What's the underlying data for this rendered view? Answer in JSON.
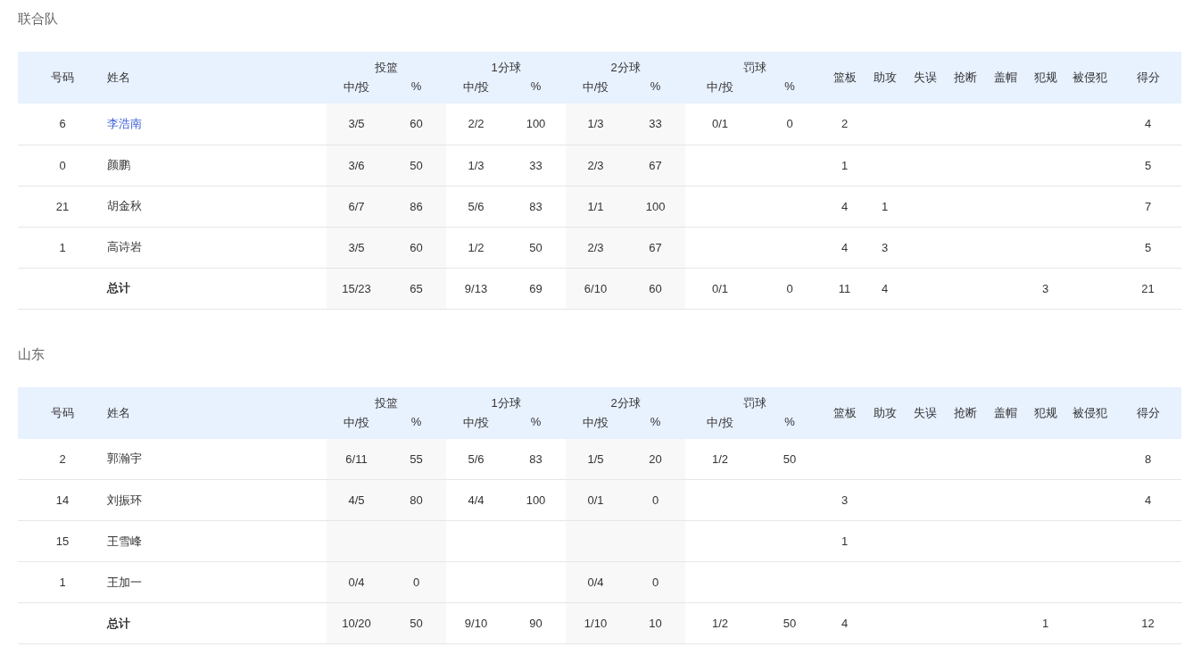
{
  "teams": [
    {
      "name": "联合队",
      "columns": [
        {
          "label": "号码"
        },
        {
          "label": "姓名"
        },
        {
          "label": "投篮",
          "sub": [
            "中/投",
            "%"
          ]
        },
        {
          "label": "1分球",
          "sub": [
            "中/投",
            "%"
          ]
        },
        {
          "label": "2分球",
          "sub": [
            "中/投",
            "%"
          ]
        },
        {
          "label": "罚球",
          "sub": [
            "中/投",
            "%"
          ]
        },
        {
          "label": "篮板"
        },
        {
          "label": "助攻"
        },
        {
          "label": "失误"
        },
        {
          "label": "抢断"
        },
        {
          "label": "盖帽"
        },
        {
          "label": "犯规"
        },
        {
          "label": "被侵犯"
        },
        {
          "label": "得分"
        }
      ],
      "rows": [
        {
          "kind": "player",
          "number": "6",
          "name": "李浩南",
          "link": true,
          "stats": {
            "fg_made": "3/5",
            "fg_pct": "60",
            "one_made": "2/2",
            "one_pct": "100",
            "two_made": "1/3",
            "two_pct": "33",
            "ft_made": "0/1",
            "ft_pct": "0",
            "reb": "2",
            "pts": "4"
          }
        },
        {
          "kind": "player",
          "number": "0",
          "name": "颜鹏",
          "link": false,
          "stats": {
            "fg_made": "3/6",
            "fg_pct": "50",
            "one_made": "1/3",
            "one_pct": "33",
            "two_made": "2/3",
            "two_pct": "67",
            "reb": "1",
            "pts": "5"
          }
        },
        {
          "kind": "player",
          "number": "21",
          "name": "胡金秋",
          "link": false,
          "stats": {
            "fg_made": "6/7",
            "fg_pct": "86",
            "one_made": "5/6",
            "one_pct": "83",
            "two_made": "1/1",
            "two_pct": "100",
            "reb": "4",
            "ast": "1",
            "pts": "7"
          }
        },
        {
          "kind": "player",
          "number": "1",
          "name": "高诗岩",
          "link": false,
          "stats": {
            "fg_made": "3/5",
            "fg_pct": "60",
            "one_made": "1/2",
            "one_pct": "50",
            "two_made": "2/3",
            "two_pct": "67",
            "reb": "4",
            "ast": "3",
            "pts": "5"
          }
        },
        {
          "kind": "total",
          "name": "总计",
          "stats": {
            "fg_made": "15/23",
            "fg_pct": "65",
            "one_made": "9/13",
            "one_pct": "69",
            "two_made": "6/10",
            "two_pct": "60",
            "ft_made": "0/1",
            "ft_pct": "0",
            "reb": "11",
            "ast": "4",
            "pf": "3",
            "pts": "21"
          }
        }
      ]
    },
    {
      "name": "山东",
      "columns": [
        {
          "label": "号码"
        },
        {
          "label": "姓名"
        },
        {
          "label": "投篮",
          "sub": [
            "中/投",
            "%"
          ]
        },
        {
          "label": "1分球",
          "sub": [
            "中/投",
            "%"
          ]
        },
        {
          "label": "2分球",
          "sub": [
            "中/投",
            "%"
          ]
        },
        {
          "label": "罚球",
          "sub": [
            "中/投",
            "%"
          ]
        },
        {
          "label": "篮板"
        },
        {
          "label": "助攻"
        },
        {
          "label": "失误"
        },
        {
          "label": "抢断"
        },
        {
          "label": "盖帽"
        },
        {
          "label": "犯规"
        },
        {
          "label": "被侵犯"
        },
        {
          "label": "得分"
        }
      ],
      "rows": [
        {
          "kind": "player",
          "number": "2",
          "name": "郭瀚宇",
          "link": false,
          "stats": {
            "fg_made": "6/11",
            "fg_pct": "55",
            "one_made": "5/6",
            "one_pct": "83",
            "two_made": "1/5",
            "two_pct": "20",
            "ft_made": "1/2",
            "ft_pct": "50",
            "pts": "8"
          }
        },
        {
          "kind": "player",
          "number": "14",
          "name": "刘振环",
          "link": false,
          "stats": {
            "fg_made": "4/5",
            "fg_pct": "80",
            "one_made": "4/4",
            "one_pct": "100",
            "two_made": "0/1",
            "two_pct": "0",
            "reb": "3",
            "pts": "4"
          }
        },
        {
          "kind": "player",
          "number": "15",
          "name": "王雪峰",
          "link": false,
          "stats": {
            "reb": "1"
          }
        },
        {
          "kind": "player",
          "number": "1",
          "name": "王加一",
          "link": false,
          "stats": {
            "fg_made": "0/4",
            "fg_pct": "0",
            "two_made": "0/4",
            "two_pct": "0"
          }
        },
        {
          "kind": "total",
          "name": "总计",
          "stats": {
            "fg_made": "10/20",
            "fg_pct": "50",
            "one_made": "9/10",
            "one_pct": "90",
            "two_made": "1/10",
            "two_pct": "10",
            "ft_made": "1/2",
            "ft_pct": "50",
            "reb": "4",
            "pf": "1",
            "pts": "12"
          }
        }
      ]
    }
  ]
}
